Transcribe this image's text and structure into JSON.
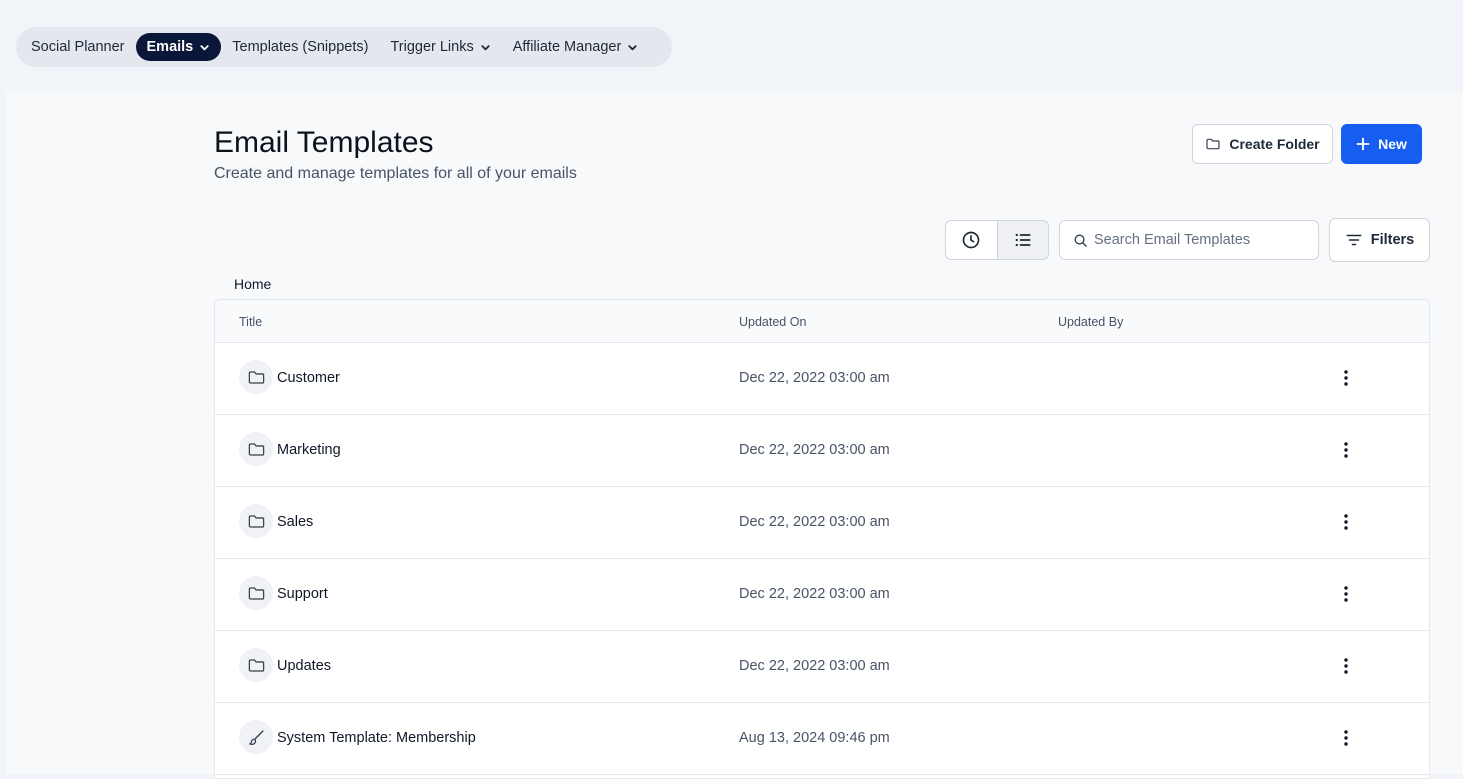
{
  "topnav": {
    "items": [
      {
        "label": "Social Planner",
        "has_dropdown": false,
        "active": false
      },
      {
        "label": "Emails",
        "has_dropdown": true,
        "active": true
      },
      {
        "label": "Templates (Snippets)",
        "has_dropdown": false,
        "active": false
      },
      {
        "label": "Trigger Links",
        "has_dropdown": true,
        "active": false
      },
      {
        "label": "Affiliate Manager",
        "has_dropdown": true,
        "active": false
      }
    ]
  },
  "header": {
    "title": "Email Templates",
    "subtitle": "Create and manage templates for all of your emails",
    "create_folder_label": "Create Folder",
    "new_label": "New"
  },
  "toolbar": {
    "search_placeholder": "Search Email Templates",
    "filters_label": "Filters",
    "active_view": "list"
  },
  "breadcrumb": "Home",
  "table": {
    "columns": [
      "Title",
      "Updated On",
      "Updated By"
    ],
    "rows": [
      {
        "icon": "folder-icon",
        "title": "Customer",
        "updated_on": "Dec 22, 2022 03:00 am",
        "updated_by": ""
      },
      {
        "icon": "folder-icon",
        "title": "Marketing",
        "updated_on": "Dec 22, 2022 03:00 am",
        "updated_by": ""
      },
      {
        "icon": "folder-icon",
        "title": "Sales",
        "updated_on": "Dec 22, 2022 03:00 am",
        "updated_by": ""
      },
      {
        "icon": "folder-icon",
        "title": "Support",
        "updated_on": "Dec 22, 2022 03:00 am",
        "updated_by": ""
      },
      {
        "icon": "folder-icon",
        "title": "Updates",
        "updated_on": "Dec 22, 2022 03:00 am",
        "updated_by": ""
      },
      {
        "icon": "brush-icon",
        "title": "System Template: Membership",
        "updated_on": "Aug 13, 2024 09:46 pm",
        "updated_by": ""
      }
    ]
  },
  "colors": {
    "active_nav_bg": "#0b1739",
    "primary": "#155eef",
    "page_bg": "#f1f4f8"
  }
}
